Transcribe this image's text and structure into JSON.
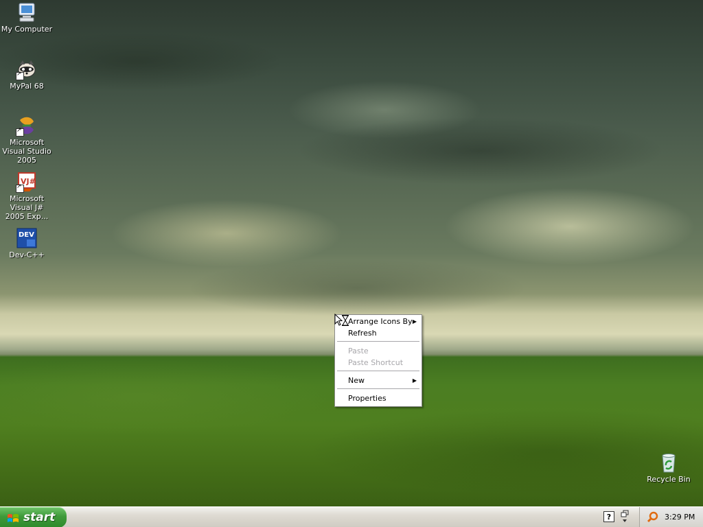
{
  "desktop": {
    "icons": [
      {
        "label": "My Computer",
        "icon": "my-computer-icon"
      },
      {
        "label": "MyPal 68",
        "icon": "mypal-raccoon-icon"
      },
      {
        "label": "Microsoft Visual Studio 2005",
        "icon": "visual-studio-icon"
      },
      {
        "label": "Microsoft Visual J# 2005 Exp...",
        "icon": "visual-jsharp-icon"
      },
      {
        "label": "Dev-C++",
        "icon": "dev-cpp-icon"
      },
      {
        "label": "Recycle Bin",
        "icon": "recycle-bin-icon"
      }
    ]
  },
  "context_menu": {
    "items": [
      {
        "label": "Arrange Icons By",
        "submenu": true,
        "enabled": true
      },
      {
        "label": "Refresh",
        "submenu": false,
        "enabled": true
      },
      {
        "label": "Paste",
        "submenu": false,
        "enabled": false
      },
      {
        "label": "Paste Shortcut",
        "submenu": false,
        "enabled": false
      },
      {
        "label": "New",
        "submenu": true,
        "enabled": true
      },
      {
        "label": "Properties",
        "submenu": false,
        "enabled": true
      }
    ],
    "submenu_arrow": "▶"
  },
  "taskbar": {
    "start_label": "start",
    "help_glyph": "?",
    "clock": "3:29 PM"
  }
}
